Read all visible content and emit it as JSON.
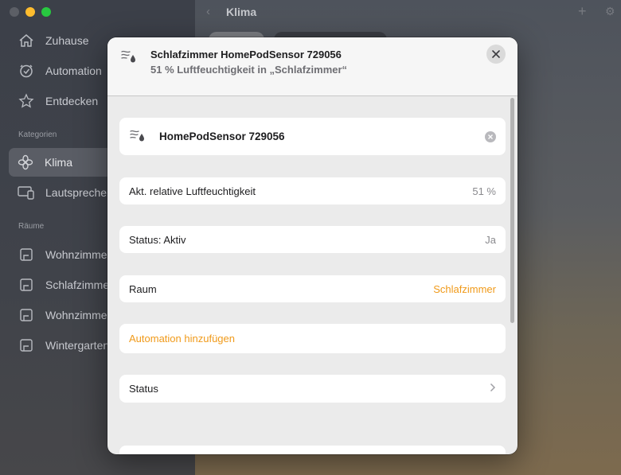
{
  "window": {
    "title": "Klima"
  },
  "sidebar": {
    "items": [
      {
        "label": "Zuhause",
        "icon": "house-icon"
      },
      {
        "label": "Automation",
        "icon": "clock-check-icon"
      },
      {
        "label": "Entdecken",
        "icon": "star-icon"
      }
    ],
    "section_categories": "Kategorien",
    "categories": [
      {
        "label": "Klima",
        "icon": "fan-icon",
        "selected": true
      },
      {
        "label": "Lautsprecher",
        "icon": "speaker-tv-icon"
      }
    ],
    "section_rooms": "Räume",
    "rooms": [
      {
        "label": "Wohnzimmer",
        "icon": "room-icon"
      },
      {
        "label": "Schlafzimmer",
        "icon": "room-icon"
      },
      {
        "label": "Wohnzimmer",
        "icon": "room-icon"
      },
      {
        "label": "Wintergarten",
        "icon": "room-icon"
      }
    ]
  },
  "modal": {
    "title": "Schlafzimmer HomePodSensor 729056",
    "subtitle": "51 % Luftfeuchtigkeit in „Schlafzimmer“",
    "name_field": "HomePodSensor 729056",
    "humidity_label": "Akt. relative Luftfeuchtigkeit",
    "humidity_value": "51 %",
    "status_active_label": "Status: Aktiv",
    "status_active_value": "Ja",
    "room_label": "Raum",
    "room_value": "Schlafzimmer",
    "add_automation": "Automation hinzufügen",
    "status_label": "Status"
  },
  "colors": {
    "accent": "#f09a1a",
    "sidebar_selected": "#5a5d65"
  }
}
